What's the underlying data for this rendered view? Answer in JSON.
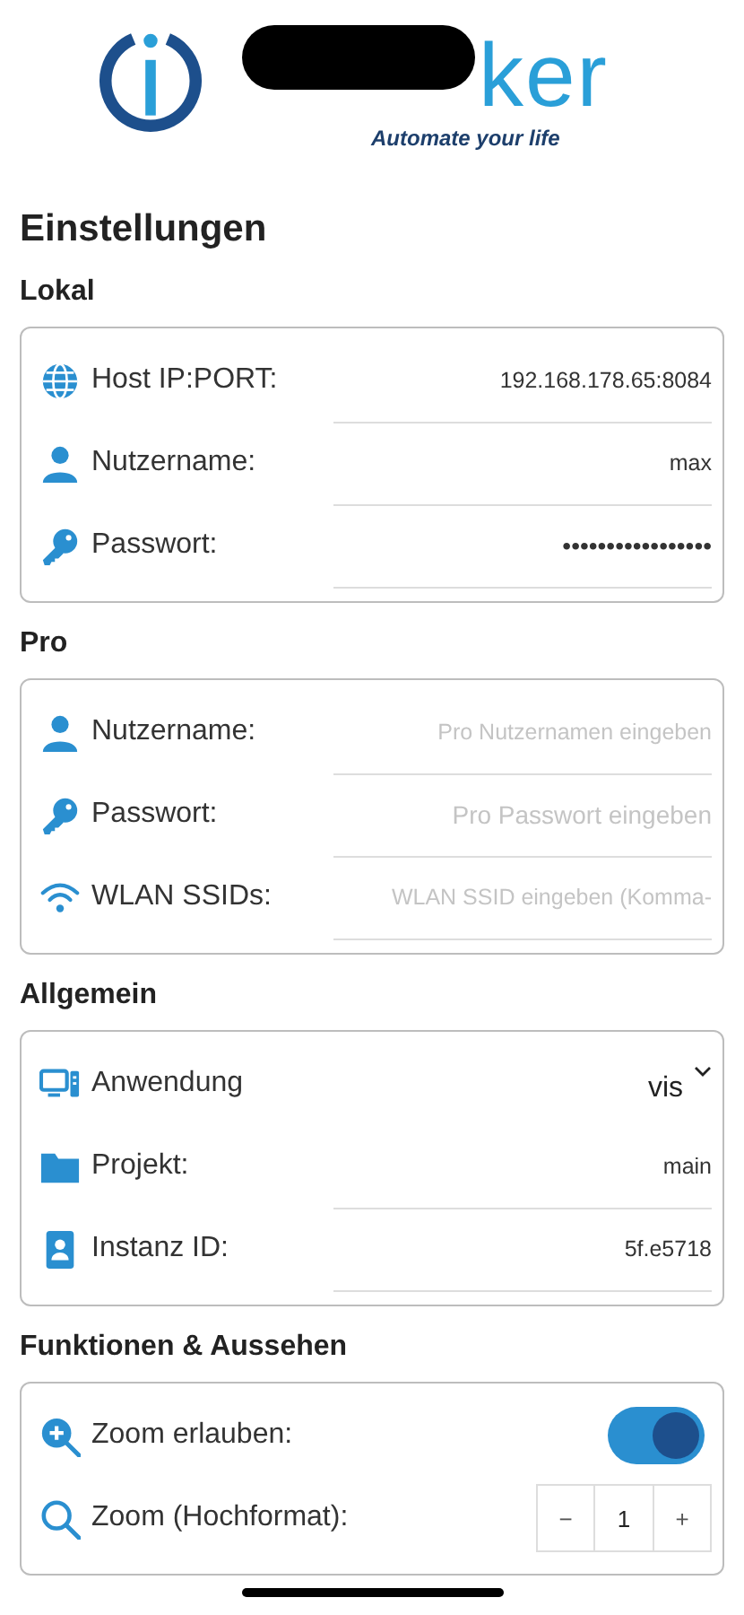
{
  "logo": {
    "wordmark": "ker",
    "tagline": "Automate your life"
  },
  "title": "Einstellungen",
  "sections": [
    {
      "heading": "Lokal",
      "rows": [
        {
          "kind": "text",
          "label": "Host IP:PORT:",
          "value": "192.168.178.65:8084"
        },
        {
          "kind": "text",
          "label": "Nutzername:",
          "value": "max"
        },
        {
          "kind": "password",
          "label": "Passwort:",
          "value": "•••••••••••••••••"
        }
      ]
    },
    {
      "heading": "Pro",
      "rows": [
        {
          "kind": "text",
          "label": "Nutzername:",
          "placeholder": "Pro Nutzernamen eingeben"
        },
        {
          "kind": "password",
          "label": "Passwort:",
          "placeholder": "Pro Passwort eingeben"
        },
        {
          "kind": "text",
          "label": "WLAN SSIDs:",
          "placeholder": "WLAN SSID eingeben (Komma-"
        }
      ]
    },
    {
      "heading": "Allgemein",
      "rows": [
        {
          "kind": "select",
          "label": "Anwendung",
          "value": "vis"
        },
        {
          "kind": "text",
          "label": "Projekt:",
          "value": "main"
        },
        {
          "kind": "text",
          "label": "Instanz ID:",
          "value": "5f.e5718"
        }
      ]
    },
    {
      "heading": "Funktionen & Aussehen",
      "rows": [
        {
          "kind": "switch",
          "label": "Zoom erlauben:",
          "on": true
        },
        {
          "kind": "stepper",
          "label": "Zoom (Hochformat):",
          "value": "1",
          "minus": "−",
          "plus": "+"
        }
      ]
    }
  ]
}
